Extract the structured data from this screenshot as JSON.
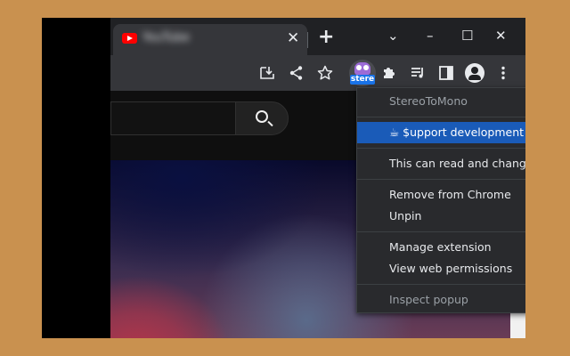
{
  "tab": {
    "title": "YouTube",
    "close_glyph": "✕",
    "new_tab_glyph": "+"
  },
  "window_controls": {
    "tab_search_glyph": "⌄",
    "minimize_glyph": "–",
    "maximize_glyph": "☐",
    "close_glyph": "✕"
  },
  "toolbar": {
    "extension_badge": "stere",
    "icons": [
      "install-app-icon",
      "share-icon",
      "bookmark-star-icon",
      "stereotomono-extension-icon",
      "extensions-puzzle-icon",
      "reading-list-icon",
      "side-panel-icon",
      "profile-avatar-icon",
      "more-menu-icon"
    ]
  },
  "menu": {
    "header": "StereoToMono",
    "support": "☕ $upport development ☕",
    "site_data": "This can read and change site data",
    "remove": "Remove from Chrome",
    "unpin": "Unpin",
    "manage": "Manage extension",
    "permissions": "View web permissions",
    "inspect": "Inspect popup"
  },
  "colors": {
    "page_background": "#c9914f",
    "menu_highlight": "#1a5bb8",
    "menu_background": "#292a2d"
  }
}
